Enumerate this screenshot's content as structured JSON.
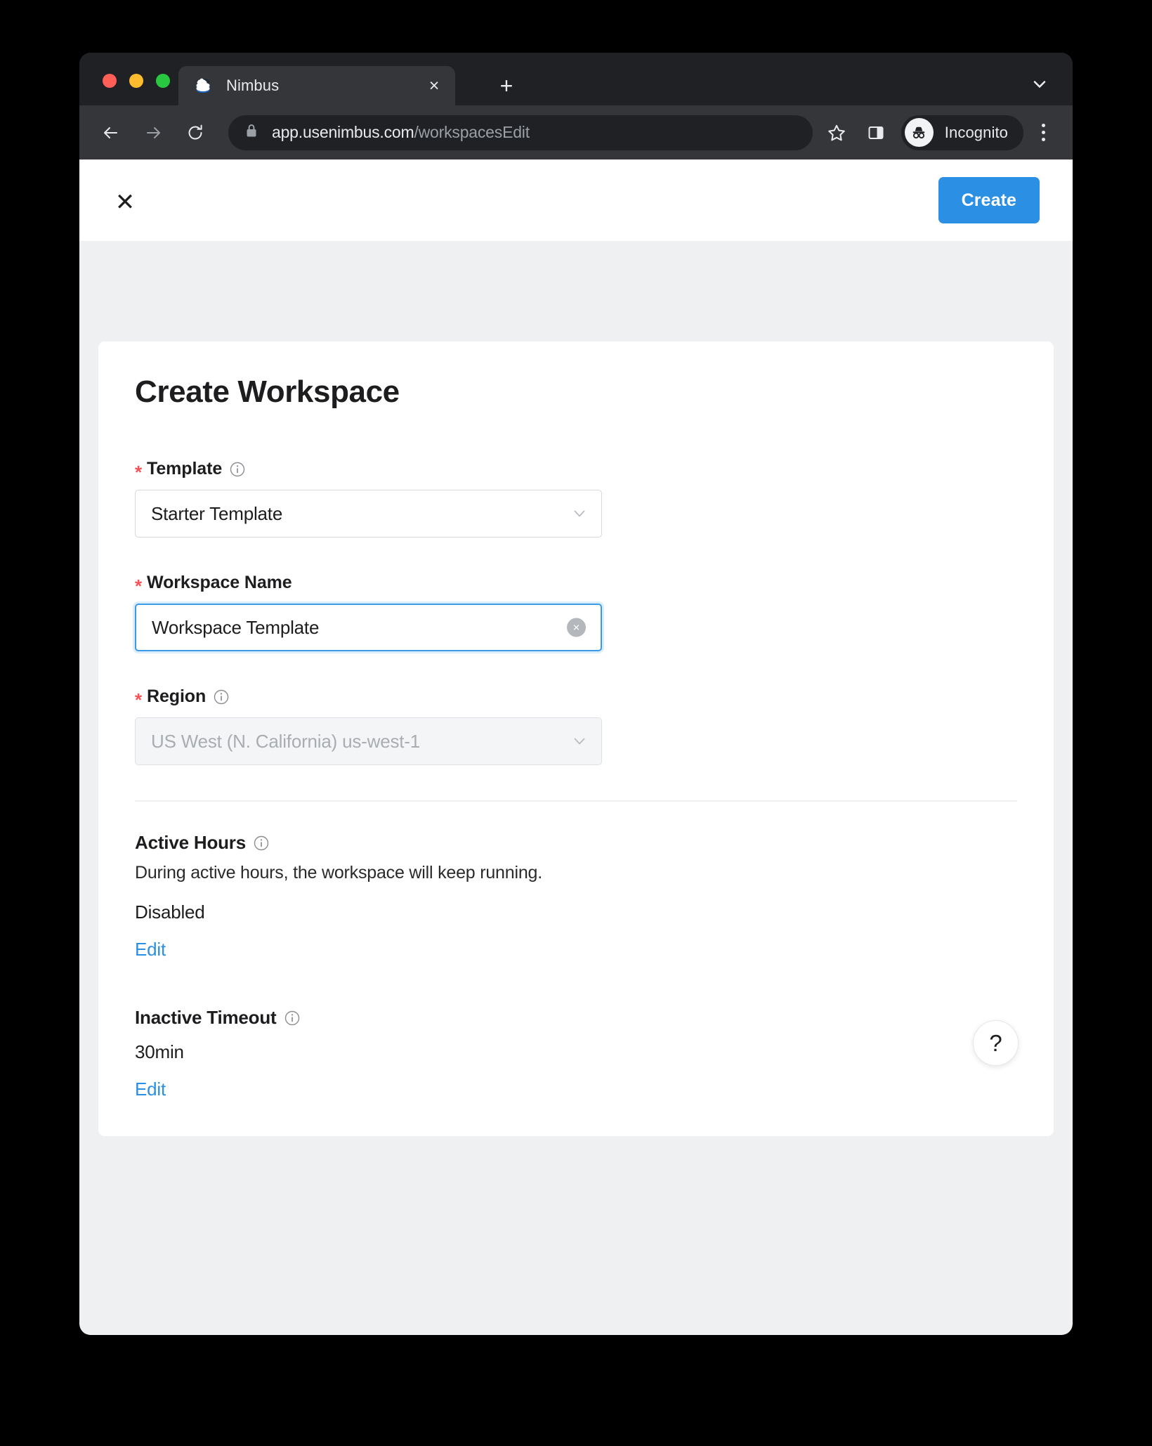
{
  "browser": {
    "tab": {
      "title": "Nimbus",
      "favicon": "layers-cloud-icon",
      "close_label": "×"
    },
    "new_tab_label": "+",
    "tabstrip_chevron": "chevron-down-icon",
    "toolbar": {
      "back": "back-arrow-icon",
      "forward": "forward-arrow-icon",
      "reload": "reload-icon",
      "lock": "lock-icon",
      "url_domain": "app.usenimbus.com",
      "url_path": "/workspacesEdit",
      "bookmark": "star-icon",
      "side_panel": "side-panel-icon",
      "profile_label": "Incognito",
      "profile_icon": "incognito-icon",
      "menu": "kebab-menu-icon"
    }
  },
  "app": {
    "header": {
      "close_label": "✕",
      "create_label": "Create",
      "accent_color": "#2b8fe3"
    },
    "page_title": "Create Workspace",
    "fields": [
      {
        "key": "template",
        "label": "Template",
        "required": true,
        "required_marker": "*",
        "info_icon": "info-icon",
        "type": "select",
        "value": "Starter Template",
        "state": "enabled",
        "chevron": "chevron-down-icon"
      },
      {
        "key": "workspace_name",
        "label": "Workspace Name",
        "required": true,
        "required_marker": "*",
        "info_icon": null,
        "type": "text",
        "value": "Workspace Template",
        "placeholder": "Workspace Name",
        "state": "focused",
        "clear_label": "×"
      },
      {
        "key": "region",
        "label": "Region",
        "required": true,
        "required_marker": "*",
        "info_icon": "info-icon",
        "type": "select",
        "value": "US West (N. California) us-west-1",
        "state": "disabled",
        "chevron": "chevron-down-icon"
      }
    ],
    "sections": [
      {
        "key": "active_hours",
        "title": "Active Hours",
        "info_icon": "info-icon",
        "description": "During active hours, the workspace will keep running.",
        "value": "Disabled",
        "edit_label": "Edit"
      },
      {
        "key": "inactive_timeout",
        "title": "Inactive Timeout",
        "info_icon": "info-icon",
        "description": "",
        "value": "30min",
        "edit_label": "Edit"
      }
    ],
    "help_label": "?"
  }
}
